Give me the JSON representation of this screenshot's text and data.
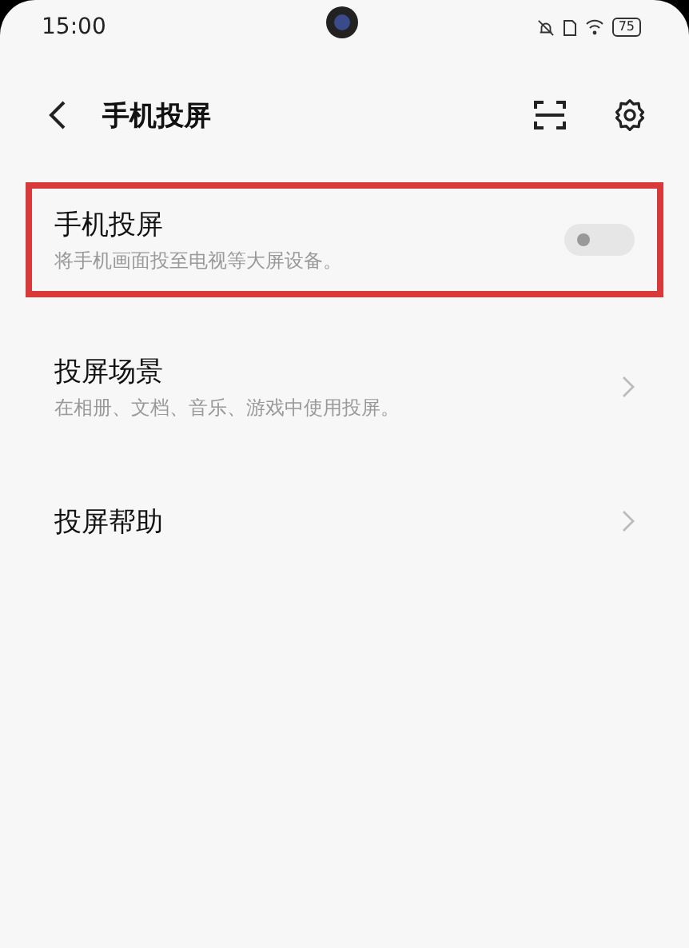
{
  "status_bar": {
    "time": "15:00",
    "battery": "75"
  },
  "header": {
    "title": "手机投屏"
  },
  "items": [
    {
      "kind": "toggle",
      "title": "手机投屏",
      "subtitle": "将手机画面投至电视等大屏设备。",
      "on": false,
      "highlighted": true
    },
    {
      "kind": "link",
      "title": "投屏场景",
      "subtitle": "在相册、文档、音乐、游戏中使用投屏。",
      "highlighted": false
    },
    {
      "kind": "link",
      "title": "投屏帮助",
      "highlighted": false
    }
  ]
}
